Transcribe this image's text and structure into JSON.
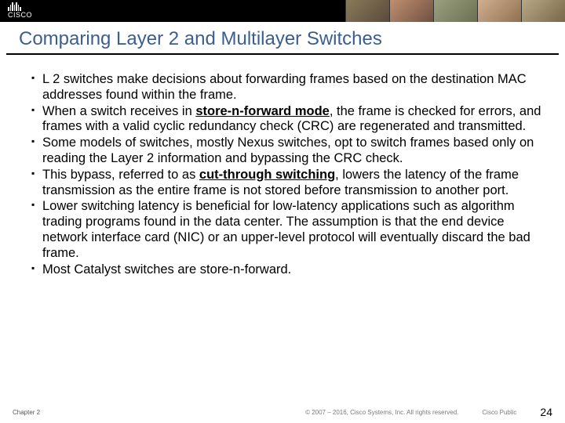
{
  "header": {
    "logo_text": "CISCO"
  },
  "slide": {
    "title": "Comparing Layer 2 and Multilayer Switches"
  },
  "bullets": [
    {
      "before": "L 2 switches make decisions about forwarding frames based on the destination MAC addresses found within the frame.",
      "bold": "",
      "after": ""
    },
    {
      "before": "When a switch receives in ",
      "bold": "store-n-forward mode",
      "after": ", the frame is checked for errors, and frames with a valid cyclic redundancy check (CRC) are regenerated and transmitted."
    },
    {
      "before": "Some models of switches, mostly Nexus switches, opt to switch frames based only on reading the Layer 2 information and bypassing the CRC check.",
      "bold": "",
      "after": ""
    },
    {
      "before": "This bypass, referred to as ",
      "bold": "cut-through switching",
      "after": ", lowers the latency of the frame transmission as the entire frame is not stored before transmission to another port."
    },
    {
      "before": "Lower switching latency is beneficial for low-latency applications such as algorithm trading programs found in the data center. The assumption is that the end device network interface card (NIC) or an upper-level protocol will eventually discard the bad frame.",
      "bold": "",
      "after": ""
    },
    {
      "before": "Most Catalyst switches are store-n-forward.",
      "bold": "",
      "after": ""
    }
  ],
  "footer": {
    "chapter": "Chapter 2",
    "copyright": "© 2007 – 2016, Cisco Systems, Inc. All rights reserved.",
    "public": "Cisco Public",
    "page": "24"
  }
}
